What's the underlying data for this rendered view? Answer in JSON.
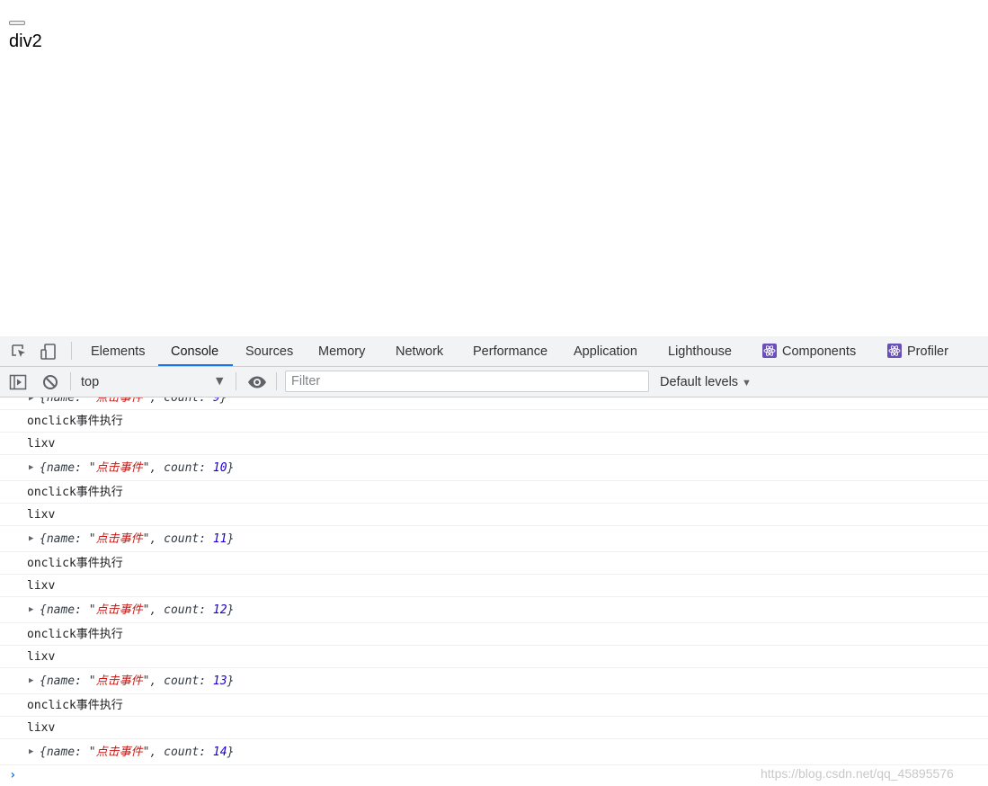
{
  "page": {
    "button_label": "",
    "text": "div2"
  },
  "devtools": {
    "tabs": [
      {
        "label": "Elements"
      },
      {
        "label": "Console",
        "active": true
      },
      {
        "label": "Sources"
      },
      {
        "label": "Memory"
      },
      {
        "label": "Network"
      },
      {
        "label": "Performance"
      },
      {
        "label": "Application"
      },
      {
        "label": "Lighthouse"
      },
      {
        "label": "Components"
      },
      {
        "label": "Profiler"
      }
    ],
    "toolbar": {
      "context": "top",
      "filter_placeholder": "Filter",
      "levels": "Default levels"
    },
    "logs": [
      {
        "kind": "obj",
        "name": "点击事件",
        "count": "9",
        "partial": true
      },
      {
        "kind": "text",
        "text": "onclick事件执行"
      },
      {
        "kind": "text",
        "text": "lixv"
      },
      {
        "kind": "obj",
        "name": "点击事件",
        "count": "10"
      },
      {
        "kind": "text",
        "text": "onclick事件执行"
      },
      {
        "kind": "text",
        "text": "lixv"
      },
      {
        "kind": "obj",
        "name": "点击事件",
        "count": "11"
      },
      {
        "kind": "text",
        "text": "onclick事件执行"
      },
      {
        "kind": "text",
        "text": "lixv"
      },
      {
        "kind": "obj",
        "name": "点击事件",
        "count": "12"
      },
      {
        "kind": "text",
        "text": "onclick事件执行"
      },
      {
        "kind": "text",
        "text": "lixv"
      },
      {
        "kind": "obj",
        "name": "点击事件",
        "count": "13"
      },
      {
        "kind": "text",
        "text": "onclick事件执行"
      },
      {
        "kind": "text",
        "text": "lixv"
      },
      {
        "kind": "obj",
        "name": "点击事件",
        "count": "14"
      }
    ],
    "prompt_symbol": "›"
  },
  "watermark": "https://blog.csdn.net/qq_45895576",
  "colors": {
    "accent": "#1a73e8",
    "string": "#c41a16",
    "number": "#1c00cf",
    "react_badge": "#6a4fb8"
  }
}
